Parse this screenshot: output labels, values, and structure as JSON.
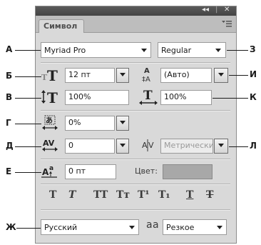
{
  "panel": {
    "tab_title": "Символ",
    "window_controls": {
      "collapse": "◂◂",
      "close": "✕"
    },
    "menu_icon": "panel-menu-icon"
  },
  "callouts": {
    "a": "А",
    "b": "Б",
    "v": "В",
    "g": "Г",
    "d": "Д",
    "e": "Е",
    "zh": "Ж",
    "z": "З",
    "i": "И",
    "k": "К",
    "l": "Л"
  },
  "font": {
    "family": "Myriad Pro",
    "style": "Regular"
  },
  "size": {
    "font_size": "12 пт",
    "leading": "(Авто)"
  },
  "scale": {
    "vertical": "100%",
    "horizontal": "100%"
  },
  "tsume": "0%",
  "kerning": {
    "tracking": "0",
    "kerning": "Метрически"
  },
  "baseline_shift": "0 пт",
  "color_label": "Цвет:",
  "color_value": "#a8a8a8",
  "style_buttons": [
    {
      "glyph": "T",
      "name": "faux-bold"
    },
    {
      "glyph": "T",
      "name": "faux-italic"
    },
    {
      "glyph": "TT",
      "name": "all-caps"
    },
    {
      "glyph": "Tт",
      "name": "small-caps"
    },
    {
      "glyph": "T¹",
      "name": "superscript"
    },
    {
      "glyph": "T₁",
      "name": "subscript"
    },
    {
      "glyph": "T",
      "name": "underline"
    },
    {
      "glyph": "T",
      "name": "strikethrough"
    }
  ],
  "language": "Русский",
  "antialias_label": "a a",
  "antialias": "Резкое"
}
